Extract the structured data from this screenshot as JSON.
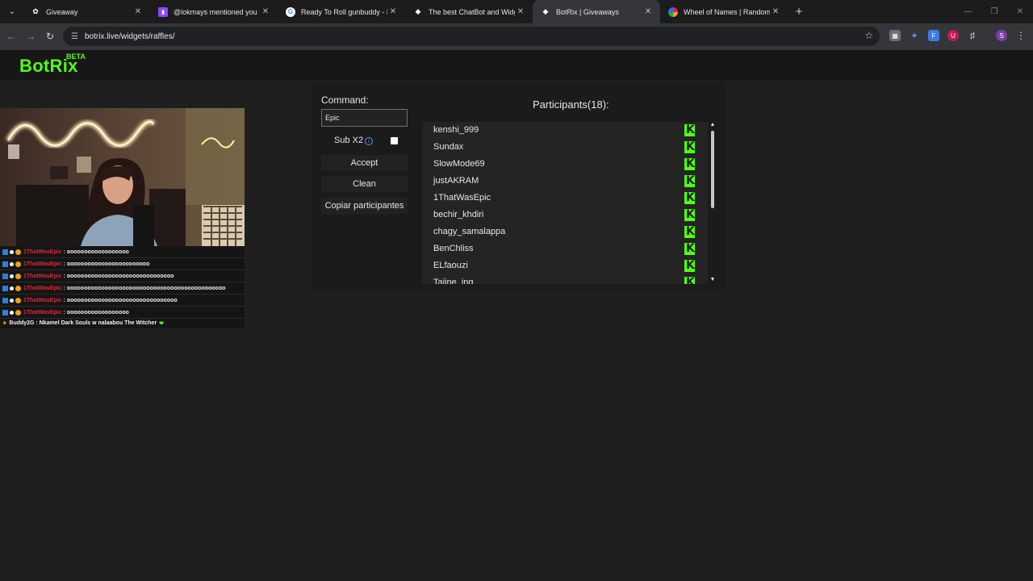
{
  "browser": {
    "tabs": [
      {
        "title": "Giveaway",
        "icon": "paw-icon",
        "color": "#ffffff",
        "active": false
      },
      {
        "title": "@lokmays mentioned you",
        "icon": "twitch-icon",
        "color": "#9146ff",
        "active": false
      },
      {
        "title": "Ready To Roll gunbuddy - Reci",
        "icon": "google-icon",
        "color": "#4285f4",
        "active": false
      },
      {
        "title": "The best ChatBot and Widgets",
        "icon": "botrix-icon",
        "color": "#ffffff",
        "active": false
      },
      {
        "title": "BotRix | Giveaways",
        "icon": "botrix-icon",
        "color": "#ffffff",
        "active": true
      },
      {
        "title": "Wheel of Names | Random nam",
        "icon": "wheel-icon",
        "color": "#e0263a",
        "active": false
      }
    ],
    "url": "botrix.live/widgets/raffles/"
  },
  "app": {
    "logo": "BotRix",
    "beta": "BETA",
    "accent": "#53fc18"
  },
  "raffle": {
    "command_label": "Command:",
    "command_value": "Epic",
    "sub_label": "Sub X2",
    "sub_checked": false,
    "accept_label": "Accept",
    "clean_label": "Clean",
    "copy_label": "Copiar participantes"
  },
  "participants": {
    "title": "Participants(18):",
    "items": [
      "kenshi_999",
      "Sundax",
      "SlowMode69",
      "justAKRAM",
      "1ThatWasEpic",
      "bechir_khdiri",
      "chagy_samalappa",
      "BenChliss",
      "ELfaouzi",
      "Tajine_ing"
    ]
  },
  "chat": {
    "messages": [
      {
        "user": "1ThatWasEpic",
        "text": ": oooooooooooooooooo"
      },
      {
        "user": "1ThatWasEpic",
        "text": ": oooooooooooooooooooooooo"
      },
      {
        "user": "1ThatWasEpic",
        "text": ": ooooooooooooooooooooooooooooooo"
      },
      {
        "user": "1ThatWasEpic",
        "text": ": oooooooooooooooooooooooooooooooooooooooooooooo"
      },
      {
        "user": "1ThatWasEpic",
        "text": ": oooooooooooooooooooooooooooooooo"
      },
      {
        "user": "1ThatWasEpic",
        "text": ": oooooooooooooooooo"
      }
    ],
    "last": {
      "user": "Buddy2G",
      "text": ": Nkamel Dark Souls w nalaabou The Witcher"
    }
  }
}
